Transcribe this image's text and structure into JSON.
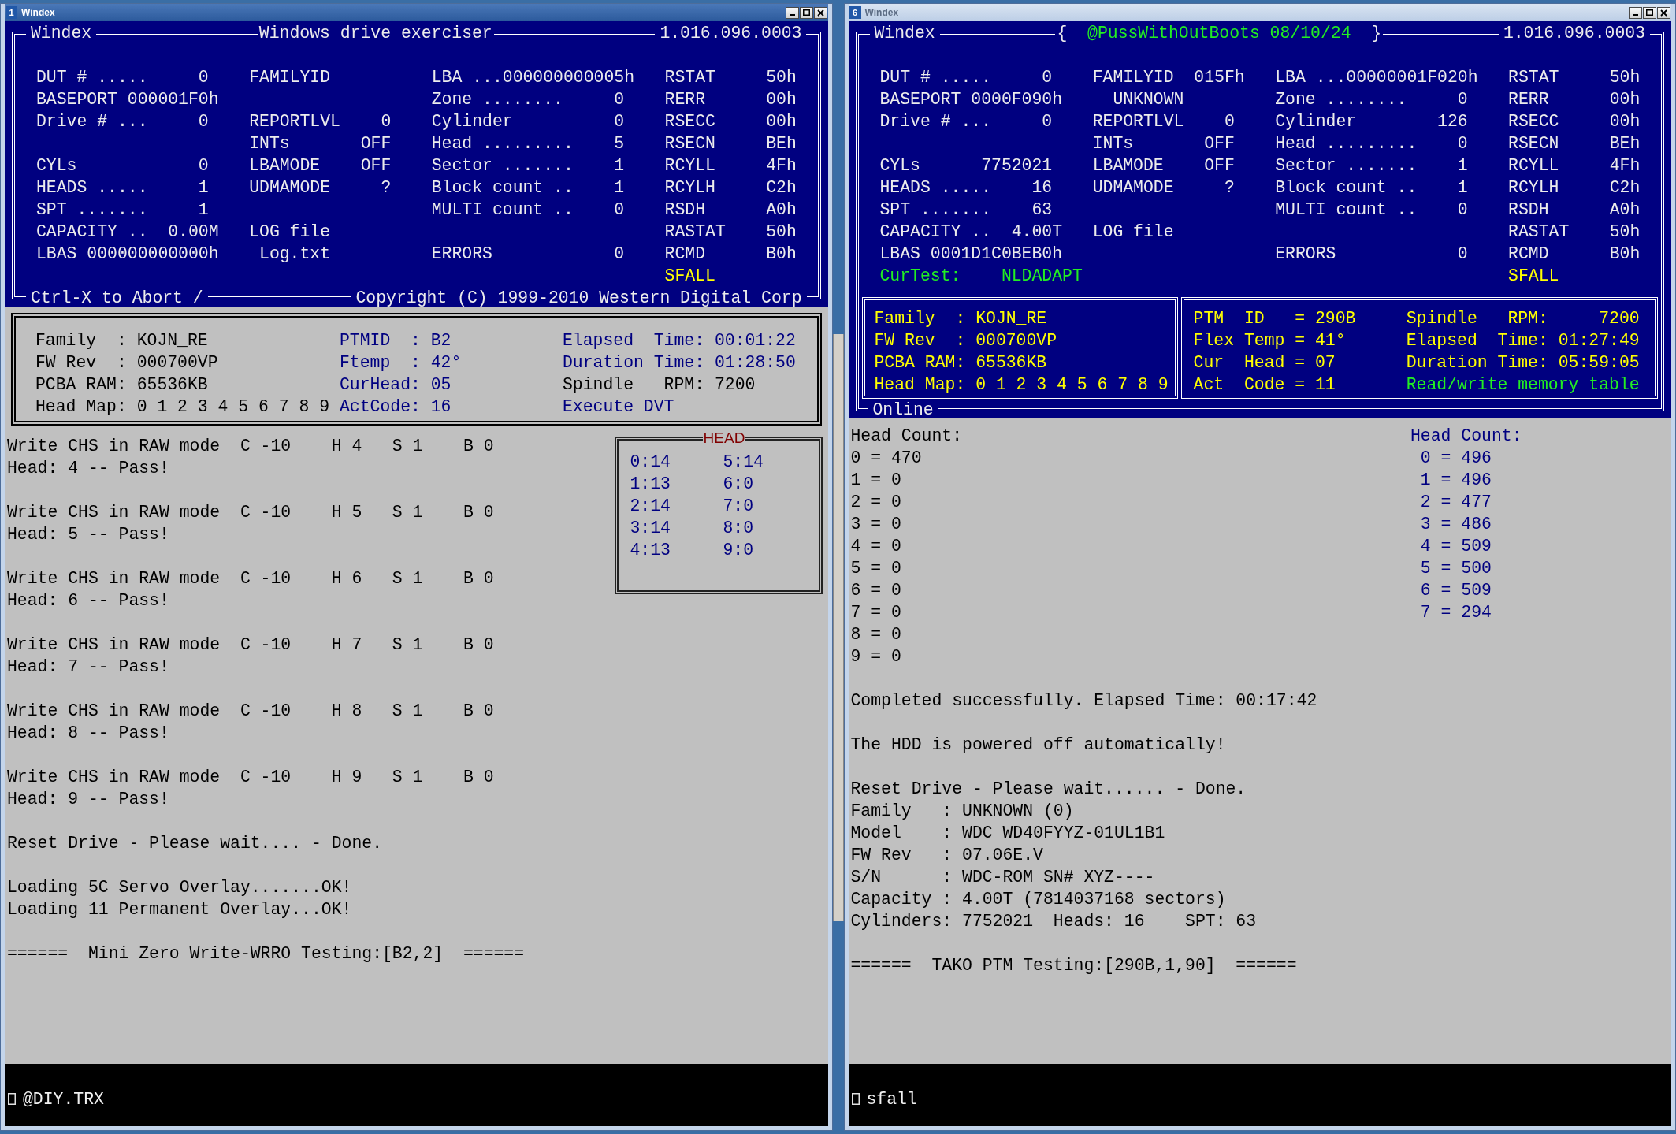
{
  "windows": [
    {
      "title_bar": {
        "number": "1",
        "title": "Windex",
        "active": true
      },
      "header": {
        "app": "Windex",
        "center": [
          {
            "text": "Windows drive exerciser",
            "kind": "normal"
          }
        ],
        "version": "1.016.096.0003",
        "rows": [
          {
            "column_1": "DUT # .....     0",
            "column_2": "FAMILYID",
            "column_3": "LBA ...000000000005h",
            "column_4": "RSTAT     50h"
          },
          {
            "column_1": "BASEPORT 000001F0h",
            "column_3": "Zone ........     0",
            "column_4": "RERR      00h"
          },
          {
            "column_1": "Drive # ...     0",
            "column_2": "REPORTLVL    0",
            "column_3": "Cylinder          0",
            "column_4": "RSECC     00h"
          },
          {
            "column_2": "INTs       OFF",
            "column_3": "Head .........    5",
            "column_4": "RSECN     BEh"
          },
          {
            "column_1": "CYLs            0",
            "column_2": "LBAMODE    OFF",
            "column_3": "Sector .......    1",
            "column_4": "RCYLL     4Fh"
          },
          {
            "column_1": "HEADS .....     1",
            "column_2": "UDMAMODE     ?",
            "column_3": "Block count ..    1",
            "column_4": "RCYLH     C2h"
          },
          {
            "column_1": "SPT .......     1",
            "column_3": "MULTI count ..    0",
            "column_4": "RSDH      A0h"
          },
          {
            "column_1": "CAPACITY ..  0.00M",
            "column_2": "LOG file",
            "column_4": "RASTAT    50h"
          },
          {
            "column_1": "LBAS 000000000000h",
            "column_2": " Log.txt",
            "column_3": "ERRORS            0",
            "column_4": "RCMD      B0h"
          },
          {
            "column_4": {
              "text": "SFALL",
              "kind": "accent"
            }
          }
        ],
        "footer": {
          "left": "Ctrl-X to Abort /",
          "right": "Copyright (C) 1999-2010 Western Digital Corp"
        }
      },
      "info": {
        "kind": "light",
        "boxes": [
          {
            "columns": [
              [
                {
                  "text": "Family  : KOJN_RE",
                  "kind": "normal"
                },
                {
                  "text": "FW Rev  : 000700VP",
                  "kind": "normal"
                },
                {
                  "text": "PCBA RAM: 65536KB",
                  "kind": "normal"
                },
                {
                  "text": "Head Map: 0 1 2 3 4 5 6 7 8 9",
                  "kind": "normal"
                }
              ],
              [
                {
                  "text": "PTMID  : B2",
                  "kind": "info"
                },
                {
                  "text": "Ftemp  : 42°",
                  "kind": "info"
                },
                {
                  "text": "CurHead: 05",
                  "kind": "info"
                },
                {
                  "text": "ActCode: 16",
                  "kind": "info"
                }
              ],
              [
                {
                  "text": "Elapsed  Time: 00:01:22",
                  "kind": "info"
                },
                {
                  "text": "Duration Time: 01:28:50",
                  "kind": "info"
                },
                {
                  "text": "Spindle   RPM: 7200",
                  "kind": "normal"
                },
                {
                  "text": "Execute DVT",
                  "kind": "info"
                }
              ]
            ]
          }
        ]
      },
      "log": {
        "blocks": [
          [
            "Write CHS in RAW mode  C -10    H 4   S 1    B 0",
            "Head: 4 -- Pass!"
          ],
          [
            "Write CHS in RAW mode  C -10    H 5   S 1    B 0",
            "Head: 5 -- Pass!"
          ],
          [
            "Write CHS in RAW mode  C -10    H 6   S 1    B 0",
            "Head: 6 -- Pass!"
          ],
          [
            "Write CHS in RAW mode  C -10    H 7   S 1    B 0",
            "Head: 7 -- Pass!"
          ],
          [
            "Write CHS in RAW mode  C -10    H 8   S 1    B 0",
            "Head: 8 -- Pass!"
          ],
          [
            "Write CHS in RAW mode  C -10    H 9   S 1    B 0",
            "Head: 9 -- Pass!"
          ],
          [
            "Reset Drive - Please wait.... - Done."
          ],
          [
            "Loading 5C Servo Overlay.......OK!",
            "Loading 11 Permanent Overlay...OK!"
          ],
          [
            "======  Mini Zero Write-WRRO Testing:[B2,2]  ======"
          ]
        ],
        "head_box": {
          "title": "HEAD",
          "columns": [
            [
              "0:14",
              "1:13",
              "2:14",
              "3:14",
              "4:13"
            ],
            [
              "5:14",
              "6:0",
              "7:0",
              "8:0",
              "9:0"
            ]
          ]
        }
      },
      "command": {
        "text": "@DIY.TRX"
      }
    },
    {
      "title_bar": {
        "number": "6",
        "title": "Windex",
        "active": false
      },
      "header": {
        "app": "Windex",
        "center": [
          {
            "text": "{",
            "kind": "normal"
          },
          {
            "text": "@PussWithOutBoots 08/10/24",
            "kind": "active"
          },
          {
            "text": "}",
            "kind": "normal"
          }
        ],
        "version": "1.016.096.0003",
        "rows": [
          {
            "column_1": "DUT # .....     0",
            "column_2": "FAMILYID  015Fh",
            "column_3": "LBA ...00000001F020h",
            "column_4": "RSTAT     50h"
          },
          {
            "column_1": "BASEPORT 0000F090h",
            "column_2": "  UNKNOWN",
            "column_3": "Zone ........     0",
            "column_4": "RERR      00h"
          },
          {
            "column_1": "Drive # ...     0",
            "column_2": "REPORTLVL    0",
            "column_3": "Cylinder        126",
            "column_4": "RSECC     00h"
          },
          {
            "column_2": "INTs       OFF",
            "column_3": "Head .........    0",
            "column_4": "RSECN     BEh"
          },
          {
            "column_1": "CYLs      7752021",
            "column_2": "LBAMODE    OFF",
            "column_3": "Sector .......    1",
            "column_4": "RCYLL     4Fh"
          },
          {
            "column_1": "HEADS .....    16",
            "column_2": "UDMAMODE     ?",
            "column_3": "Block count ..    1",
            "column_4": "RCYLH     C2h"
          },
          {
            "column_1": "SPT .......    63",
            "column_3": "MULTI count ..    0",
            "column_4": "RSDH      A0h"
          },
          {
            "column_1": "CAPACITY ..  4.00T",
            "column_2": "LOG file",
            "column_4": "RASTAT    50h"
          },
          {
            "column_1": "LBAS 0001D1C0BEB0h",
            "column_3": "ERRORS            0",
            "column_4": "RCMD      B0h"
          },
          {
            "column_1": {
              "text": "CurTest:    NLDADAPT",
              "kind": "active"
            },
            "column_4": {
              "text": "SFALL",
              "kind": "accent"
            }
          }
        ]
      },
      "info": {
        "kind": "dark",
        "label": "Online",
        "boxes": [
          {
            "columns": [
              [
                {
                  "text": "Family  : KOJN_RE",
                  "kind": "accent"
                },
                {
                  "text": "FW Rev  : 000700VP",
                  "kind": "accent"
                },
                {
                  "text": "PCBA RAM: 65536KB",
                  "kind": "accent"
                },
                {
                  "text": "Head Map: 0 1 2 3 4 5 6 7 8 9",
                  "kind": "accent"
                }
              ]
            ]
          },
          {
            "columns": [
              [
                {
                  "text": "PTM  ID   = 290B",
                  "kind": "accent"
                },
                {
                  "text": "Flex Temp = 41°",
                  "kind": "accent"
                },
                {
                  "text": "Cur  Head = 07",
                  "kind": "accent"
                },
                {
                  "text": "Act  Code = 11",
                  "kind": "accent"
                }
              ],
              [
                {
                  "text": "Spindle   RPM:     7200",
                  "kind": "accent"
                },
                {
                  "text": "Elapsed  Time: 01:27:49",
                  "kind": "accent"
                },
                {
                  "text": "Duration Time: 05:59:05",
                  "kind": "accent"
                },
                {
                  "text": "Read/write memory table",
                  "kind": "active"
                }
              ]
            ]
          }
        ]
      },
      "log": {
        "blocks": [
          [
            "Head Count:",
            "0 = 470",
            "1 = 0",
            "2 = 0",
            "3 = 0",
            "4 = 0",
            "5 = 0",
            "6 = 0",
            "7 = 0",
            "8 = 0",
            "9 = 0"
          ],
          [
            "Completed successfully. Elapsed Time: 00:17:42"
          ],
          [
            "The HDD is powered off automatically!"
          ],
          [
            "Reset Drive - Please wait...... - Done.",
            "Family   : UNKNOWN (0)",
            "Model    : WDC WD40FYYZ-01UL1B1",
            "FW Rev   : 07.06E.V",
            "S/N      : WDC-ROM SN# XYZ----",
            "Capacity : 4.00T (7814037168 sectors)",
            "Cylinders: 7752021  Heads: 16    SPT: 63"
          ],
          [
            "======  TAKO PTM Testing:[290B,1,90]  ======"
          ]
        ],
        "side_list": {
          "title": "Head Count:",
          "lines": [
            "0 = 496",
            "1 = 496",
            "2 = 477",
            "3 = 486",
            "4 = 509",
            "5 = 500",
            "6 = 509",
            "7 = 294"
          ]
        }
      },
      "command": {
        "text": "sfall"
      }
    }
  ]
}
